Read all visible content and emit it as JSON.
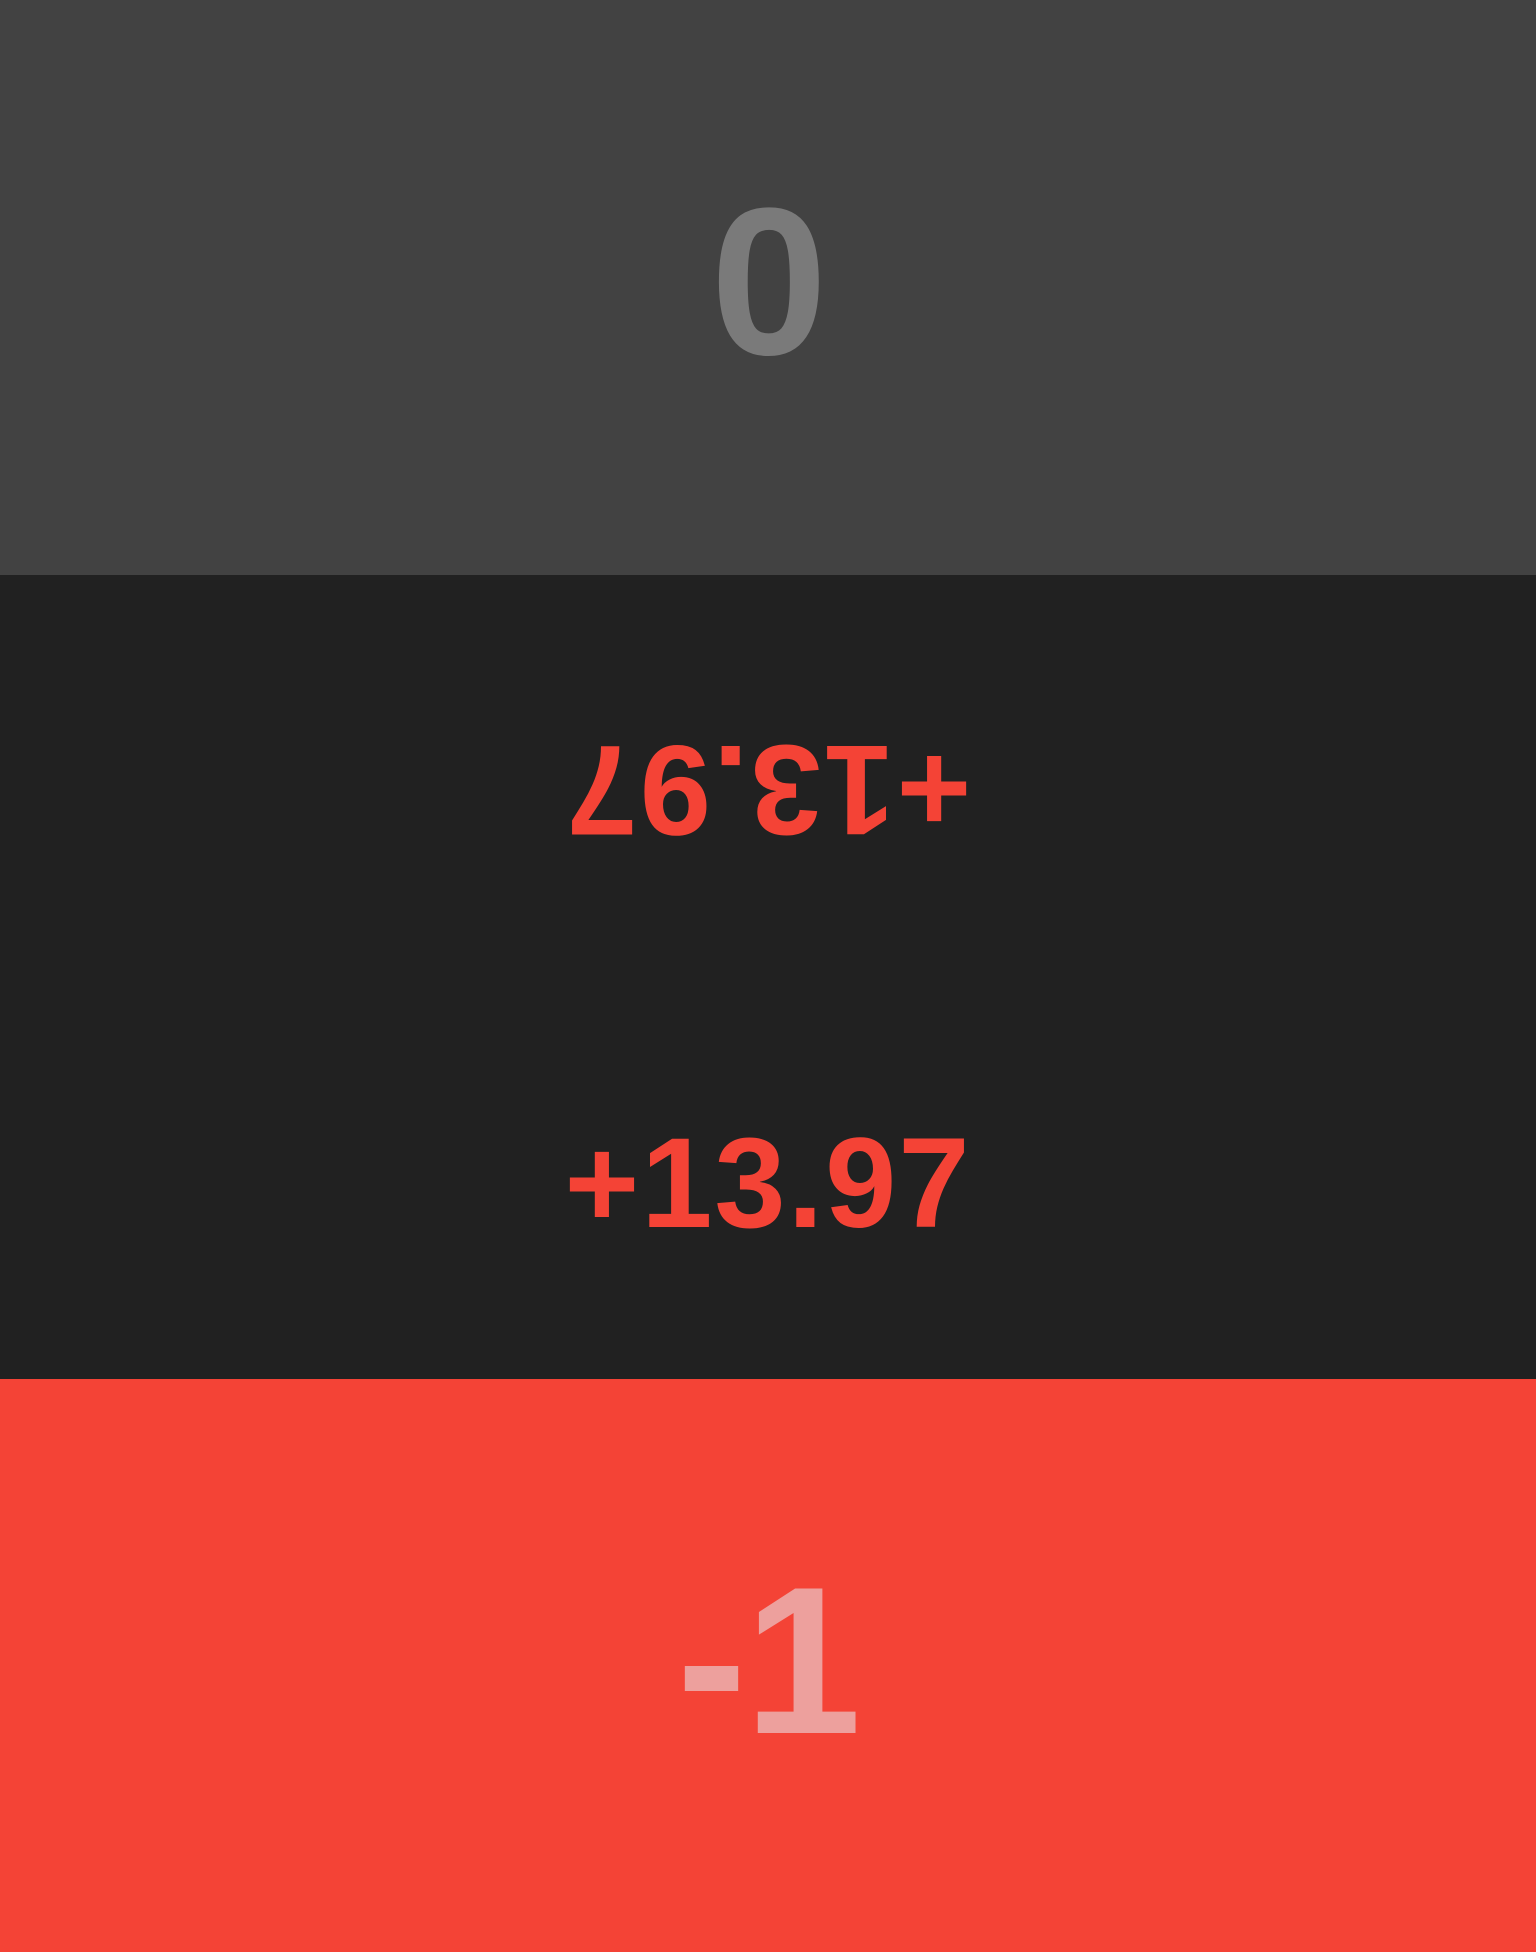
{
  "top_player": {
    "counter_value": "0",
    "color": "#424242"
  },
  "score_area": {
    "flipped_score": "+13.97",
    "score": "+13.97",
    "score_color": "#f44336",
    "background": "#212121"
  },
  "bottom_player": {
    "counter_value": "-1",
    "color": "#f44336"
  }
}
